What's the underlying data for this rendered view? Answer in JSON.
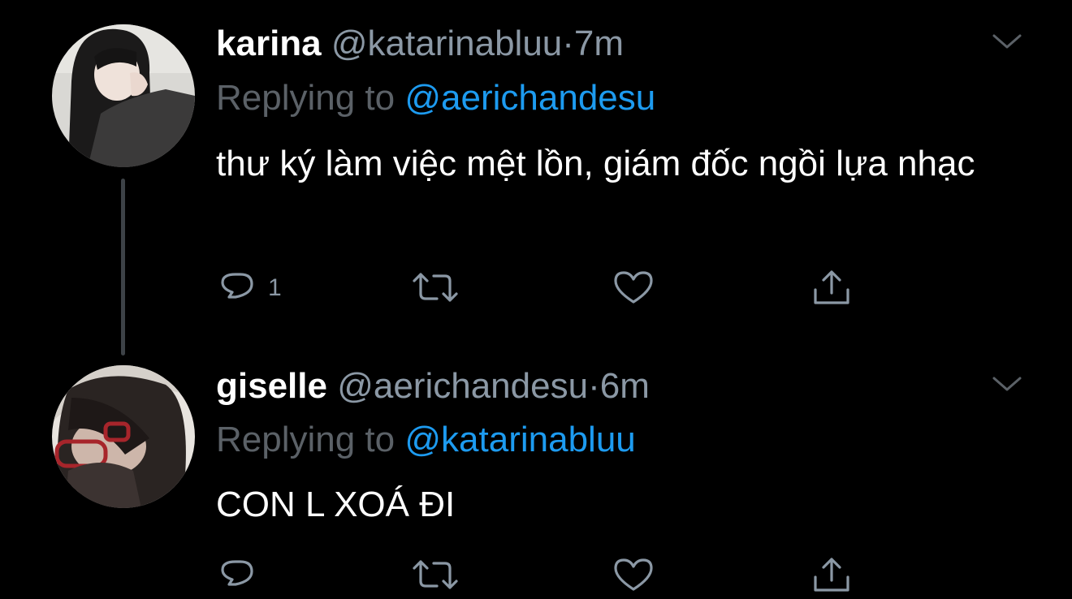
{
  "tweets": [
    {
      "display_name": "karina",
      "handle": "@katarinabluu",
      "separator": "·",
      "time": "7m",
      "replying_prefix": "Replying to",
      "replying_to": "@aerichandesu",
      "text": "thư ký làm việc mệt lồn, giám đốc ngồi lựa nhạc",
      "reply_count": "1",
      "avatar_icon": "user-avatar",
      "menu_icon": "chevron-down-icon"
    },
    {
      "display_name": "giselle",
      "handle": "@aerichandesu",
      "separator": "·",
      "time": "6m",
      "replying_prefix": "Replying to",
      "replying_to": "@katarinabluu",
      "text": "CON L XOÁ ĐI",
      "reply_count": "",
      "avatar_icon": "user-avatar",
      "menu_icon": "chevron-down-icon"
    }
  ],
  "colors": {
    "background": "#000000",
    "text_primary": "#ffffff",
    "text_secondary": "#8b98a5",
    "reply_prefix": "#5b6167",
    "mention": "#1d9bf0",
    "thread_line": "#3d4247"
  },
  "action_icons": [
    "reply-icon",
    "retweet-icon",
    "like-icon",
    "share-icon"
  ]
}
